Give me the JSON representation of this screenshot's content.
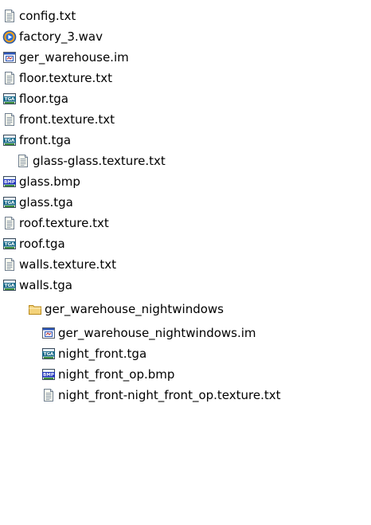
{
  "files": [
    {
      "name": "config.txt",
      "icon": "text-file-icon"
    },
    {
      "name": "factory_3.wav",
      "icon": "media-player-icon"
    },
    {
      "name": "ger_warehouse.im",
      "icon": "window-file-icon"
    },
    {
      "name": "floor.texture.txt",
      "icon": "text-file-icon"
    },
    {
      "name": "floor.tga",
      "icon": "tga-image-icon"
    },
    {
      "name": "front.texture.txt",
      "icon": "text-file-icon"
    },
    {
      "name": "front.tga",
      "icon": "tga-image-icon"
    },
    {
      "name": "glass-glass.texture.txt",
      "icon": "text-file-icon"
    },
    {
      "name": "glass.bmp",
      "icon": "bmp-image-icon"
    },
    {
      "name": "glass.tga",
      "icon": "tga-image-icon"
    },
    {
      "name": "roof.texture.txt",
      "icon": "text-file-icon"
    },
    {
      "name": "roof.tga",
      "icon": "tga-image-icon"
    },
    {
      "name": "walls.texture.txt",
      "icon": "text-file-icon"
    },
    {
      "name": "walls.tga",
      "icon": "tga-image-icon"
    }
  ],
  "folder": {
    "name": "ger_warehouse_nightwindows",
    "icon": "folder-icon",
    "children": [
      {
        "name": "ger_warehouse_nightwindows.im",
        "icon": "window-file-icon"
      },
      {
        "name": "night_front.tga",
        "icon": "tga-image-icon"
      },
      {
        "name": "night_front_op.bmp",
        "icon": "bmp-image-icon"
      },
      {
        "name": "night_front-night_front_op.texture.txt",
        "icon": "text-file-icon"
      }
    ]
  },
  "badges": {
    "tga": "TGA",
    "bmp": "BMP"
  }
}
